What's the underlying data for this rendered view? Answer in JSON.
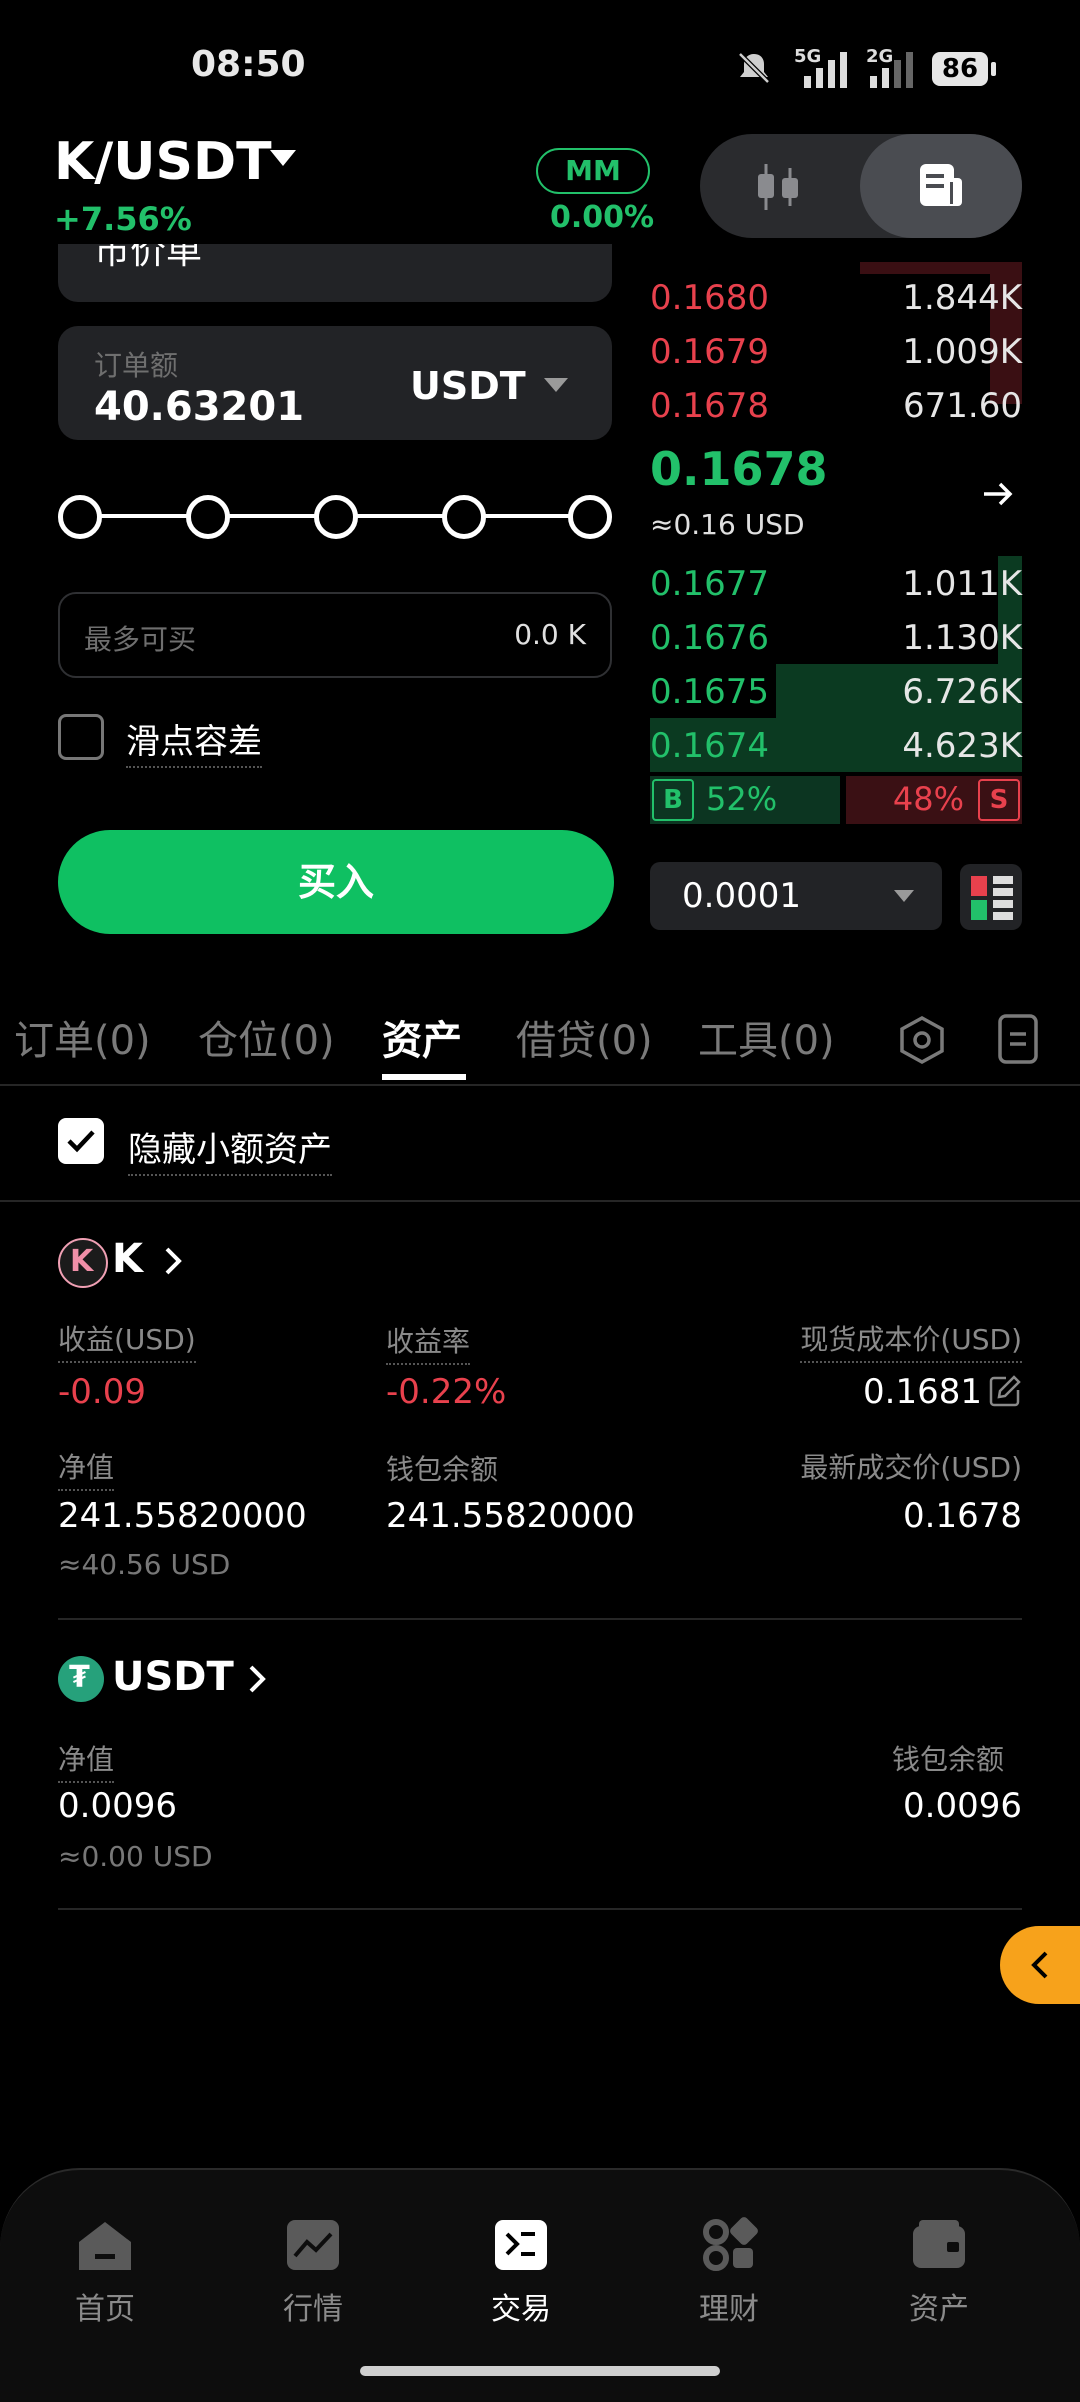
{
  "status_bar": {
    "time": "08:50",
    "signal1": "5G",
    "signal2": "2G",
    "battery": "86"
  },
  "header": {
    "pair": "K/USDT",
    "change": "+7.56%",
    "mm_label": "MM",
    "mm_value": "0.00%"
  },
  "order_form": {
    "top_field_partial": "市价单",
    "amount_label": "订单额",
    "amount_value": "40.63201",
    "amount_unit": "USDT",
    "slider_fraction": 1.0,
    "max_buy_label": "最多可买",
    "max_buy_value": "0.0 K",
    "slippage_label": "滑点容差",
    "slippage_checked": false,
    "buy_button": "买入"
  },
  "order_book": {
    "asks": [
      {
        "price": "0.1680",
        "qty": "1.844K"
      },
      {
        "price": "0.1679",
        "qty": "1.009K"
      },
      {
        "price": "0.1678",
        "qty": "671.60"
      }
    ],
    "last_price": "0.1678",
    "last_price_usd": "≈0.16 USD",
    "bids": [
      {
        "price": "0.1677",
        "qty": "1.011K"
      },
      {
        "price": "0.1676",
        "qty": "1.130K"
      },
      {
        "price": "0.1675",
        "qty": "6.726K"
      },
      {
        "price": "0.1674",
        "qty": "4.623K"
      }
    ],
    "buy_tag": "B",
    "buy_ratio": "52%",
    "sell_tag": "S",
    "sell_ratio": "48%",
    "tick_size": "0.0001"
  },
  "tabs": [
    {
      "label": "订单(0)"
    },
    {
      "label": "仓位(0)"
    },
    {
      "label": "资产"
    },
    {
      "label": "借贷(0)"
    },
    {
      "label": "工具(0)"
    }
  ],
  "hide_small": {
    "label": "隐藏小额资产",
    "checked": true
  },
  "assets": {
    "k": {
      "name": "K",
      "pnl_label": "收益(USD)",
      "pnl_value": "-0.09",
      "pnl_rate_label": "收益率",
      "pnl_rate_value": "-0.22%",
      "cost_label": "现货成本价(USD)",
      "cost_value": "0.1681",
      "net_label": "净值",
      "net_value": "241.55820000",
      "net_usd": "≈40.56 USD",
      "wallet_label": "钱包余额",
      "wallet_value": "241.55820000",
      "last_label": "最新成交价(USD)",
      "last_value": "0.1678"
    },
    "usdt": {
      "name": "USDT",
      "net_label": "净值",
      "net_value": "0.0096",
      "net_usd": "≈0.00 USD",
      "wallet_label": "钱包余额",
      "wallet_value": "0.0096"
    }
  },
  "bottom_nav": [
    {
      "label": "首页"
    },
    {
      "label": "行情"
    },
    {
      "label": "交易"
    },
    {
      "label": "理财"
    },
    {
      "label": "资产"
    }
  ],
  "colors": {
    "green": "#22c06a",
    "red": "#e8414d",
    "buy_button": "#0fc062",
    "float_tab": "#f7a21b"
  }
}
